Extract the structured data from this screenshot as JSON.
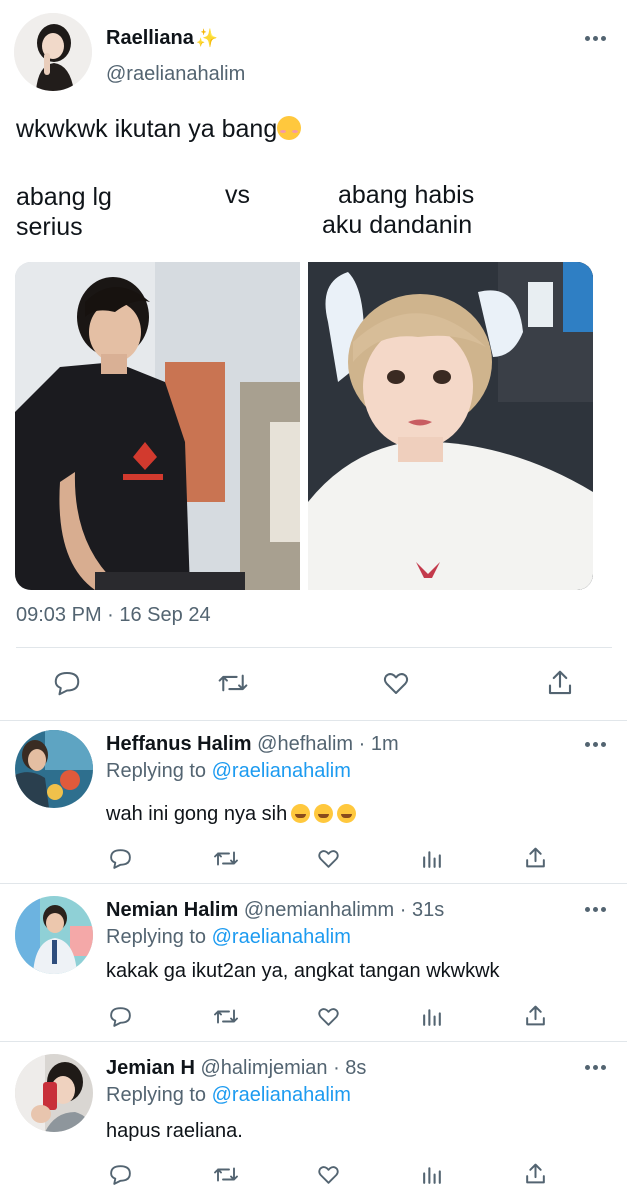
{
  "main_tweet": {
    "author_name": "Raelliana",
    "author_sparkle": "✨",
    "author_handle": "@raelianahalim",
    "line1": "wkwkwk ikutan ya bang",
    "left_line1": "abang lg",
    "left_line2": "serius",
    "vs": "vs",
    "right_line1": "abang habis",
    "right_line2": "aku dandanin",
    "timestamp": "09:03 PM · 16 Sep 24"
  },
  "replies": [
    {
      "name": "Heffanus Halim",
      "meta": "@hefhalim · 1m",
      "replying_prefix": "Replying to",
      "replying_to": "@raelianahalim",
      "text": "wah ini gong nya sih"
    },
    {
      "name": "Nemian Halim",
      "meta": "@nemianhalimm · 31s",
      "replying_prefix": "Replying to",
      "replying_to": "@raelianahalim",
      "text": "kakak ga ikut2an ya, angkat tangan wkwkwk"
    },
    {
      "name": "Jemian H",
      "meta": "@halimjemian · 8s",
      "replying_prefix": "Replying to",
      "replying_to": "@raelianahalim",
      "text": "hapus raeliana."
    }
  ],
  "icons": {
    "reply": "reply-icon",
    "retweet": "retweet-icon",
    "like": "like-icon",
    "share": "share-icon",
    "analytics": "analytics-icon",
    "more": "more-icon"
  },
  "colors": {
    "text": "#0f1419",
    "secondary": "#536471",
    "link": "#1d9bf0",
    "divider": "#e1e6ea"
  }
}
